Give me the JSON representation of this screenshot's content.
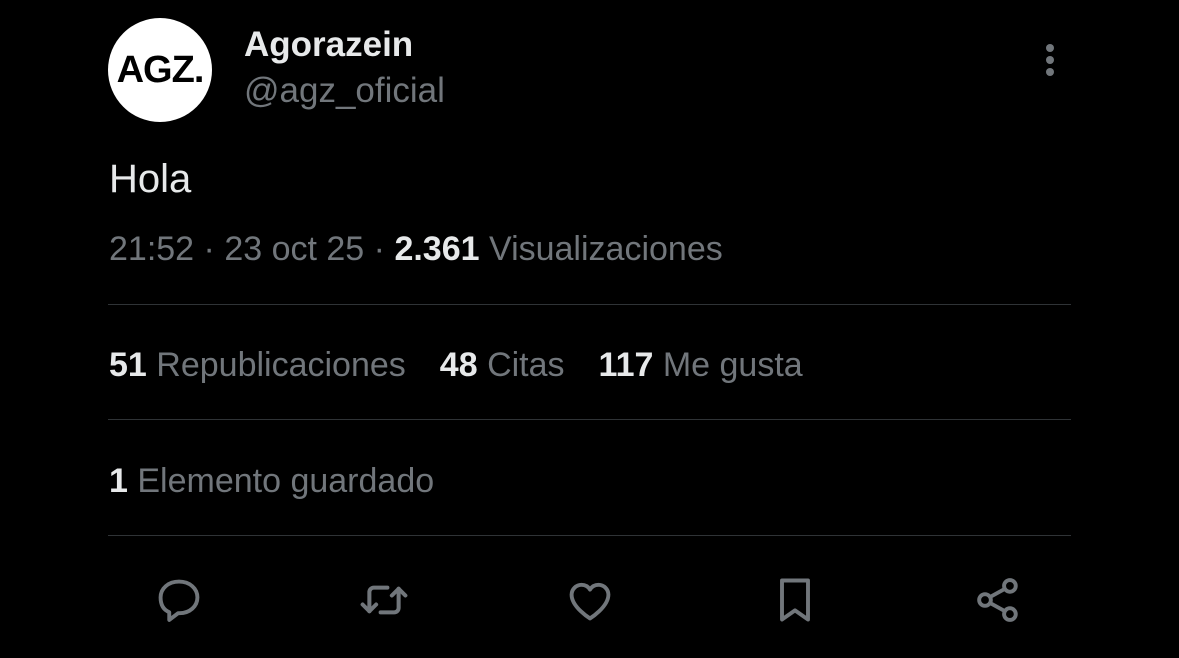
{
  "author": {
    "avatar_text": "AGZ.",
    "display_name": "Agorazein",
    "handle": "@agz_oficial"
  },
  "tweet": {
    "text": "Hola",
    "time": "21:52",
    "date": "23 oct 25",
    "separator": "·",
    "views_count": "2.361",
    "views_label": "Visualizaciones"
  },
  "stats": {
    "reposts_count": "51",
    "reposts_label": "Republicaciones",
    "quotes_count": "48",
    "quotes_label": "Citas",
    "likes_count": "117",
    "likes_label": "Me gusta",
    "bookmarks_count": "1",
    "bookmarks_label": "Elemento guardado"
  },
  "actions": {
    "icons": [
      "reply-icon",
      "repost-icon",
      "like-icon",
      "bookmark-icon",
      "share-icon"
    ]
  },
  "colors": {
    "background": "#000000",
    "primary_text": "#e7e9ea",
    "secondary_text": "#71767b",
    "divider": "#2f3336"
  }
}
